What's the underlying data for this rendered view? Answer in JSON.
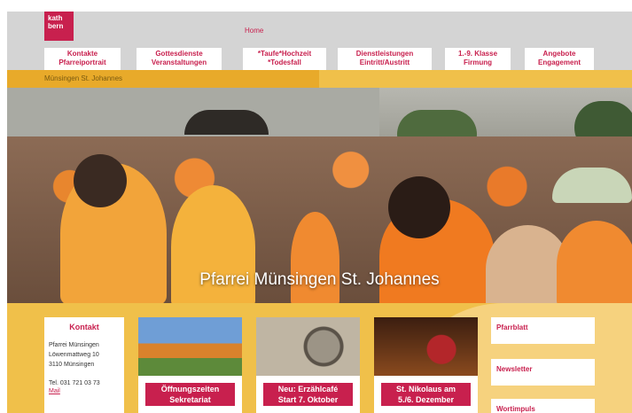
{
  "logo": {
    "line1": "kath",
    "line2": "bern"
  },
  "header": {
    "home": "Home"
  },
  "nav": [
    {
      "line1": "Kontakte",
      "line2": "Pfarreiportrait"
    },
    {
      "line1": "Gottesdienste",
      "line2": "Veranstaltungen"
    },
    {
      "line1": "*Taufe*Hochzeit",
      "line2": "*Todesfall"
    },
    {
      "line1": "Dienstleistungen",
      "line2": "Eintritt/Austritt"
    },
    {
      "line1": "1.-9. Klasse",
      "line2": "Firmung"
    },
    {
      "line1": "Angebote",
      "line2": "Engagement"
    }
  ],
  "breadcrumb": "Münsingen St. Johannes",
  "hero": {
    "title": "Pfarrei Münsingen St. Johannes"
  },
  "kontakt": {
    "title": "Kontakt",
    "name": "Pfarrei Münsingen",
    "street": "Löwenmattweg 10",
    "city": "3110 Münsingen",
    "tel": "Tel. 031 721 03 73",
    "mail": "Mail"
  },
  "tiles": [
    {
      "line1": "Öffnungszeiten",
      "line2": "Sekretariat"
    },
    {
      "line1": "Neu: Erzählcafé",
      "line2": "Start 7. Oktober"
    },
    {
      "line1": "St. Nikolaus am",
      "line2": "5./6. Dezember"
    }
  ],
  "side_links": [
    "Pfarrblatt",
    "Newsletter",
    "Wortimpuls"
  ],
  "colors": {
    "brand": "#c8204e",
    "accent": "#f0c04a",
    "header": "#d4d4d4"
  }
}
